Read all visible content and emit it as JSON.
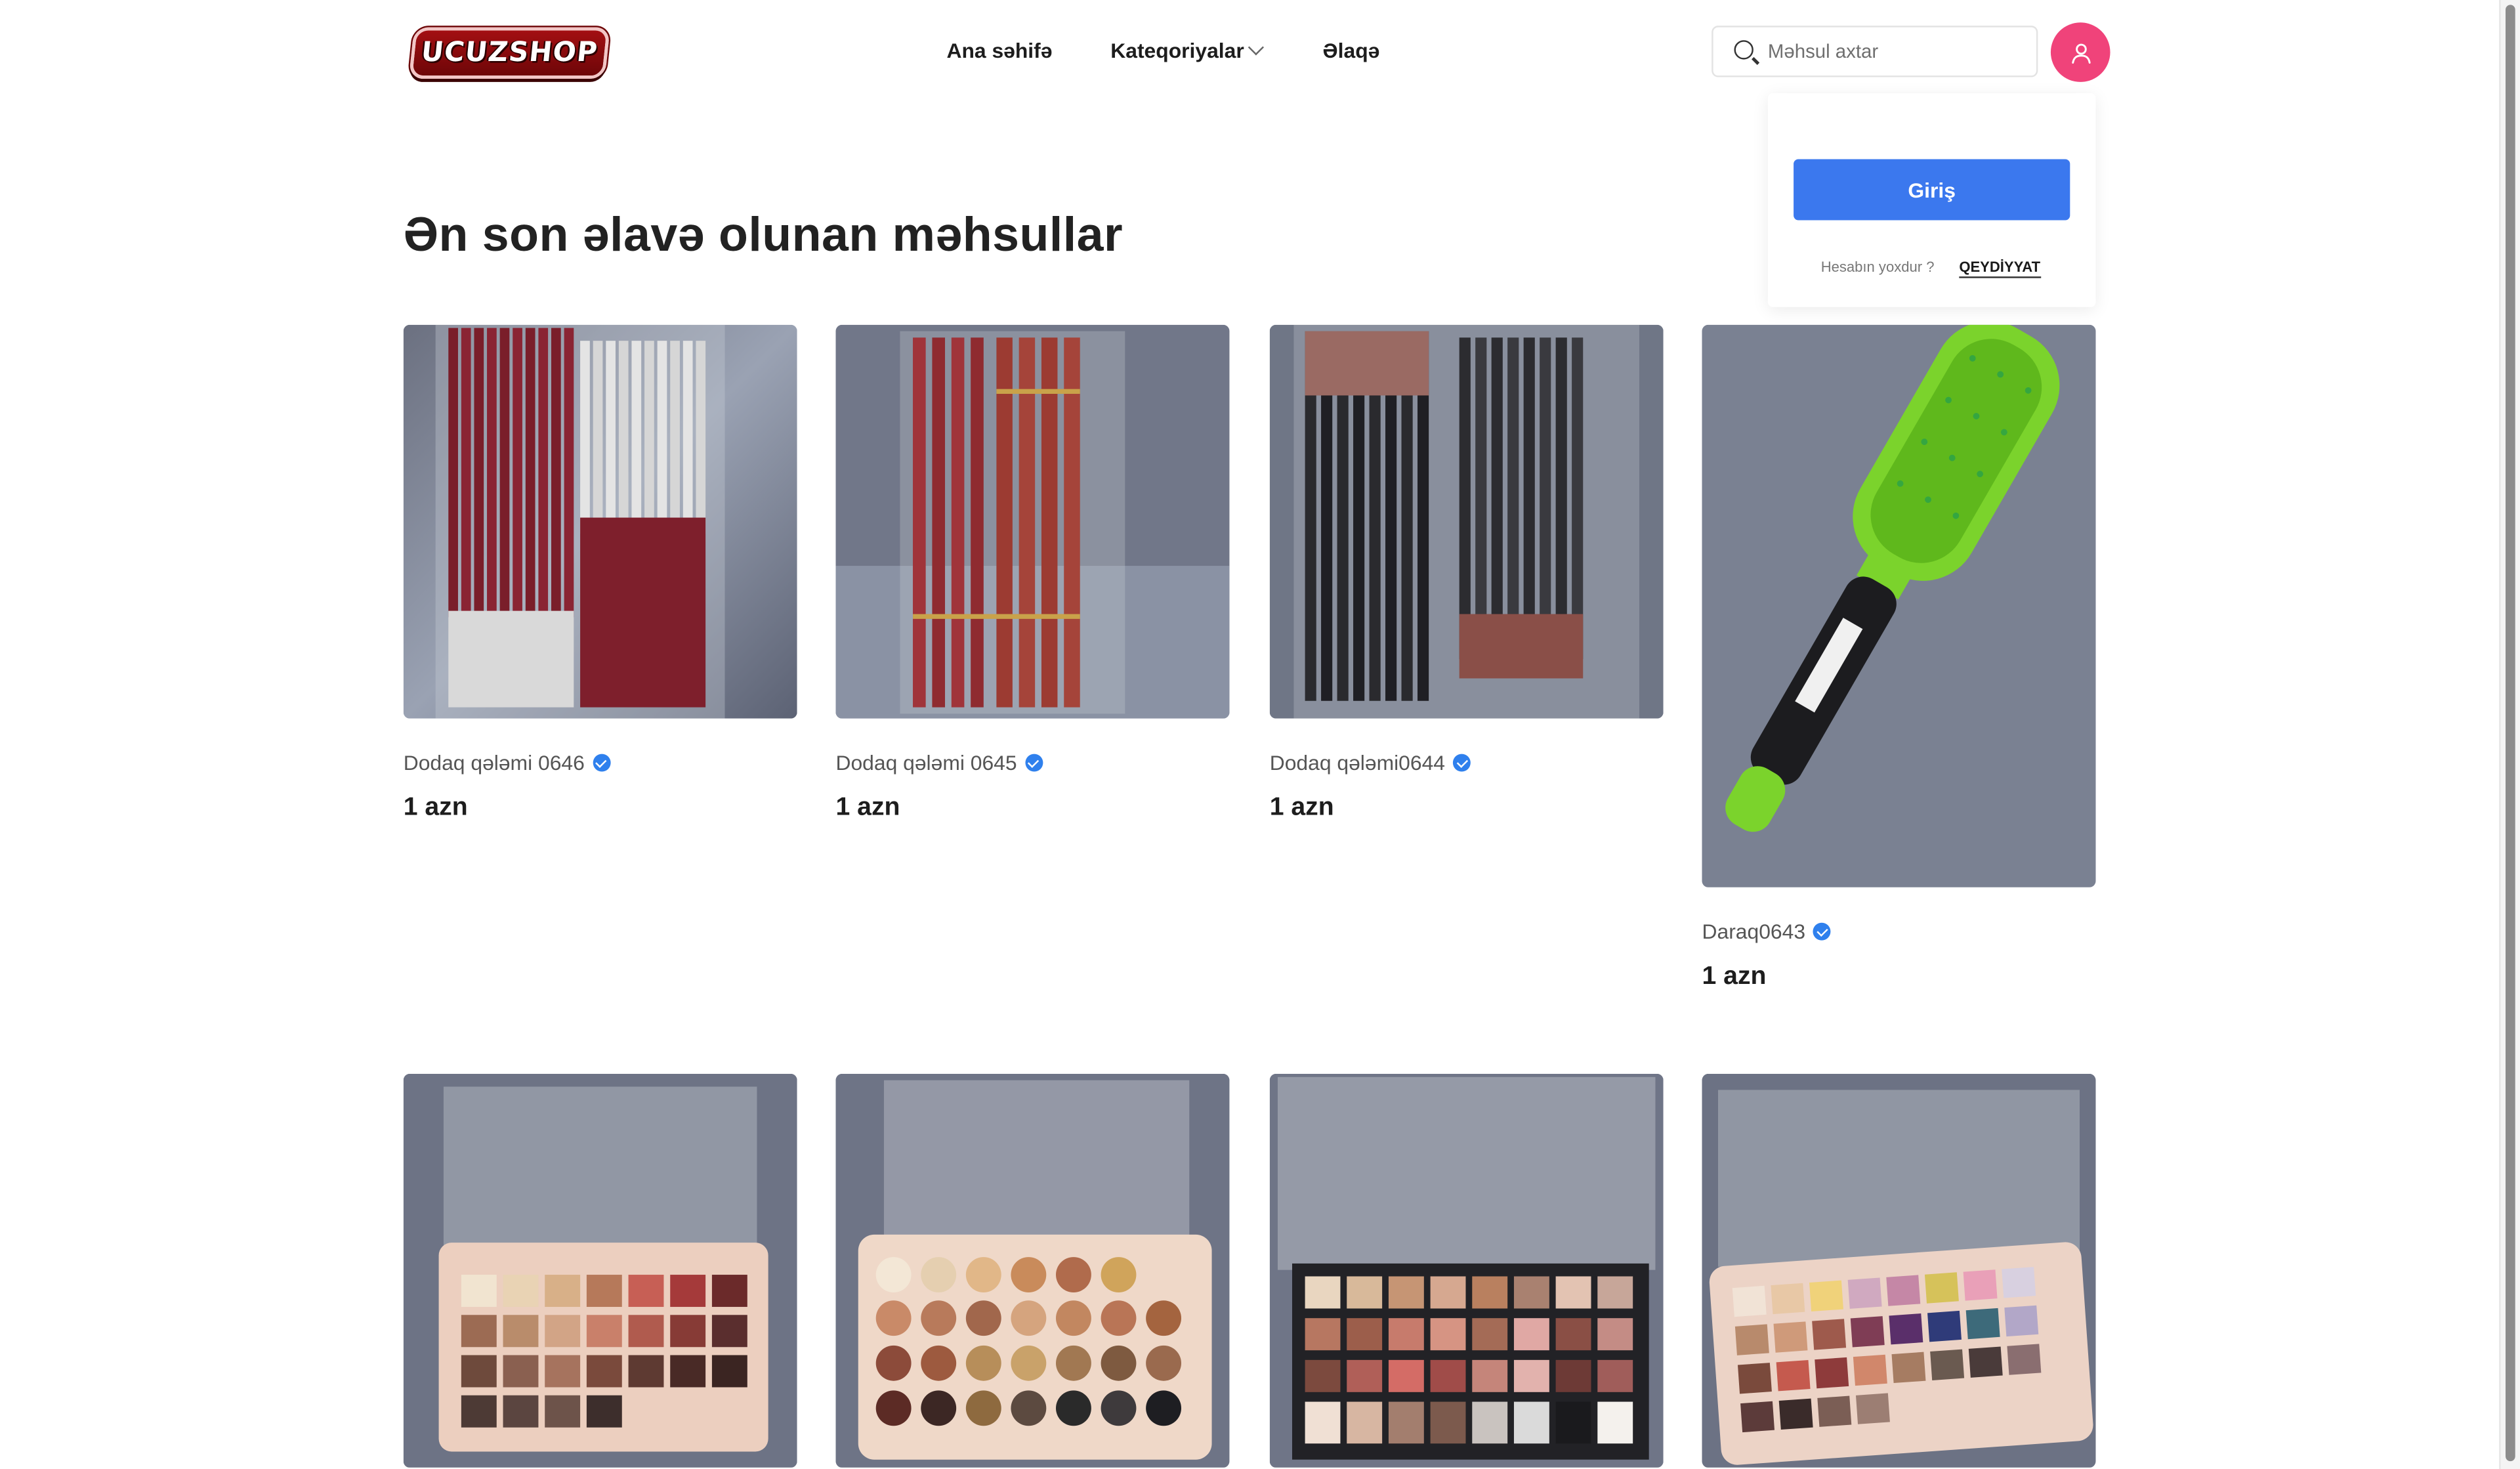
{
  "header": {
    "logo_text": "UCUZSHOP",
    "nav": [
      {
        "label": "Ana səhifə"
      },
      {
        "label": "Kateqoriyalar"
      },
      {
        "label": "Əlaqə"
      }
    ],
    "search_placeholder": "Məhsul axtar"
  },
  "account_dropdown": {
    "login_label": "Giriş",
    "no_account_text": "Hesabın yoxdur ?",
    "register_label": "QEYDİYYAT"
  },
  "main": {
    "section_title": "Ən son əlavə olunan məhsullar",
    "products": [
      {
        "name": "Dodaq qələmi 0646",
        "price": "1 azn",
        "verified": true,
        "image": "lip-pencils-burgundy-silver"
      },
      {
        "name": "Dodaq qələmi 0645",
        "price": "1 azn",
        "verified": true,
        "image": "lip-pencils-red-gold"
      },
      {
        "name": "Dodaq qələmi0644",
        "price": "1 azn",
        "verified": true,
        "image": "lip-pencils-black-brown"
      },
      {
        "name": "Daraq0643",
        "price": "1 azn",
        "verified": true,
        "image": "green-hair-brush"
      },
      {
        "image": "eyeshadow-palette-only-best"
      },
      {
        "image": "eyeshadow-palette-round-pans"
      },
      {
        "image": "eyeshadow-palette-dark"
      },
      {
        "image": "eyeshadow-palette-glitter"
      }
    ]
  },
  "colors": {
    "accent_pink": "#f0437a",
    "login_blue": "#3b78ee",
    "verified_blue": "#2f80ed",
    "logo_red": "#a30f12"
  }
}
